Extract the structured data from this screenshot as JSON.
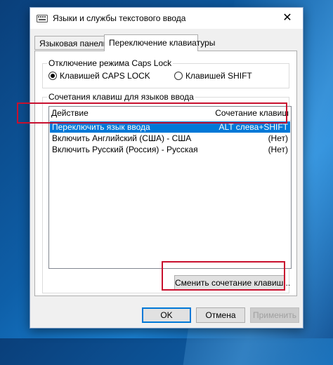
{
  "window": {
    "title": "Языки и службы текстового ввода",
    "close_glyph": "✕"
  },
  "tabs": [
    {
      "label": "Языковая панель",
      "active": false
    },
    {
      "label": "Переключение клавиатуры",
      "active": true
    }
  ],
  "caps_lock": {
    "title": "Отключение режима Caps Lock",
    "options": [
      {
        "label": "Клавишей CAPS LOCK",
        "selected": true
      },
      {
        "label": "Клавишей SHIFT",
        "selected": false
      }
    ]
  },
  "hotkeys": {
    "title": "Сочетания клавиш для языков ввода",
    "columns": {
      "action": "Действие",
      "keys": "Сочетание клавиш"
    },
    "rows": [
      {
        "action": "Переключить язык ввода",
        "keys": "ALT слева+SHIFT",
        "selected": true
      },
      {
        "action": "Включить Английский (США) - США",
        "keys": "(Нет)",
        "selected": false
      },
      {
        "action": "Включить Русский (Россия) - Русская",
        "keys": "(Нет)",
        "selected": false
      }
    ],
    "change_button": "Сменить сочетание клавиш..."
  },
  "footer": {
    "ok": "OK",
    "cancel": "Отмена",
    "apply": "Применить"
  },
  "colors": {
    "highlight": "#c8102e",
    "selection": "#0078d7"
  }
}
